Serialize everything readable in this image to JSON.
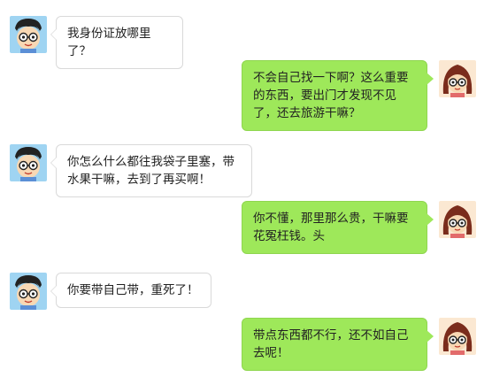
{
  "conversation": {
    "messages": [
      {
        "sender": "boy",
        "text": "我身份证放哪里了？"
      },
      {
        "sender": "girl",
        "text": "不会自己找一下啊？这么重要的东西，要出门才发现不见了，还去旅游干嘛？"
      },
      {
        "sender": "boy",
        "text": "你怎么什么都往我袋子里塞，带水果干嘛，去到了再买啊！"
      },
      {
        "sender": "girl",
        "text": "你不懂，那里那么贵，干嘛要花冤枉钱。头"
      },
      {
        "sender": "boy",
        "text": "你要带自己带，重死了！"
      },
      {
        "sender": "girl",
        "text": "带点东西都不行，还不如自己去呢！"
      }
    ]
  },
  "colors": {
    "outgoing_bubble": "#9ee85a",
    "incoming_bubble": "#ffffff",
    "incoming_border": "#d9d9d9"
  },
  "icons": {
    "boy_avatar": "boy-avatar-icon",
    "girl_avatar": "girl-avatar-icon"
  }
}
